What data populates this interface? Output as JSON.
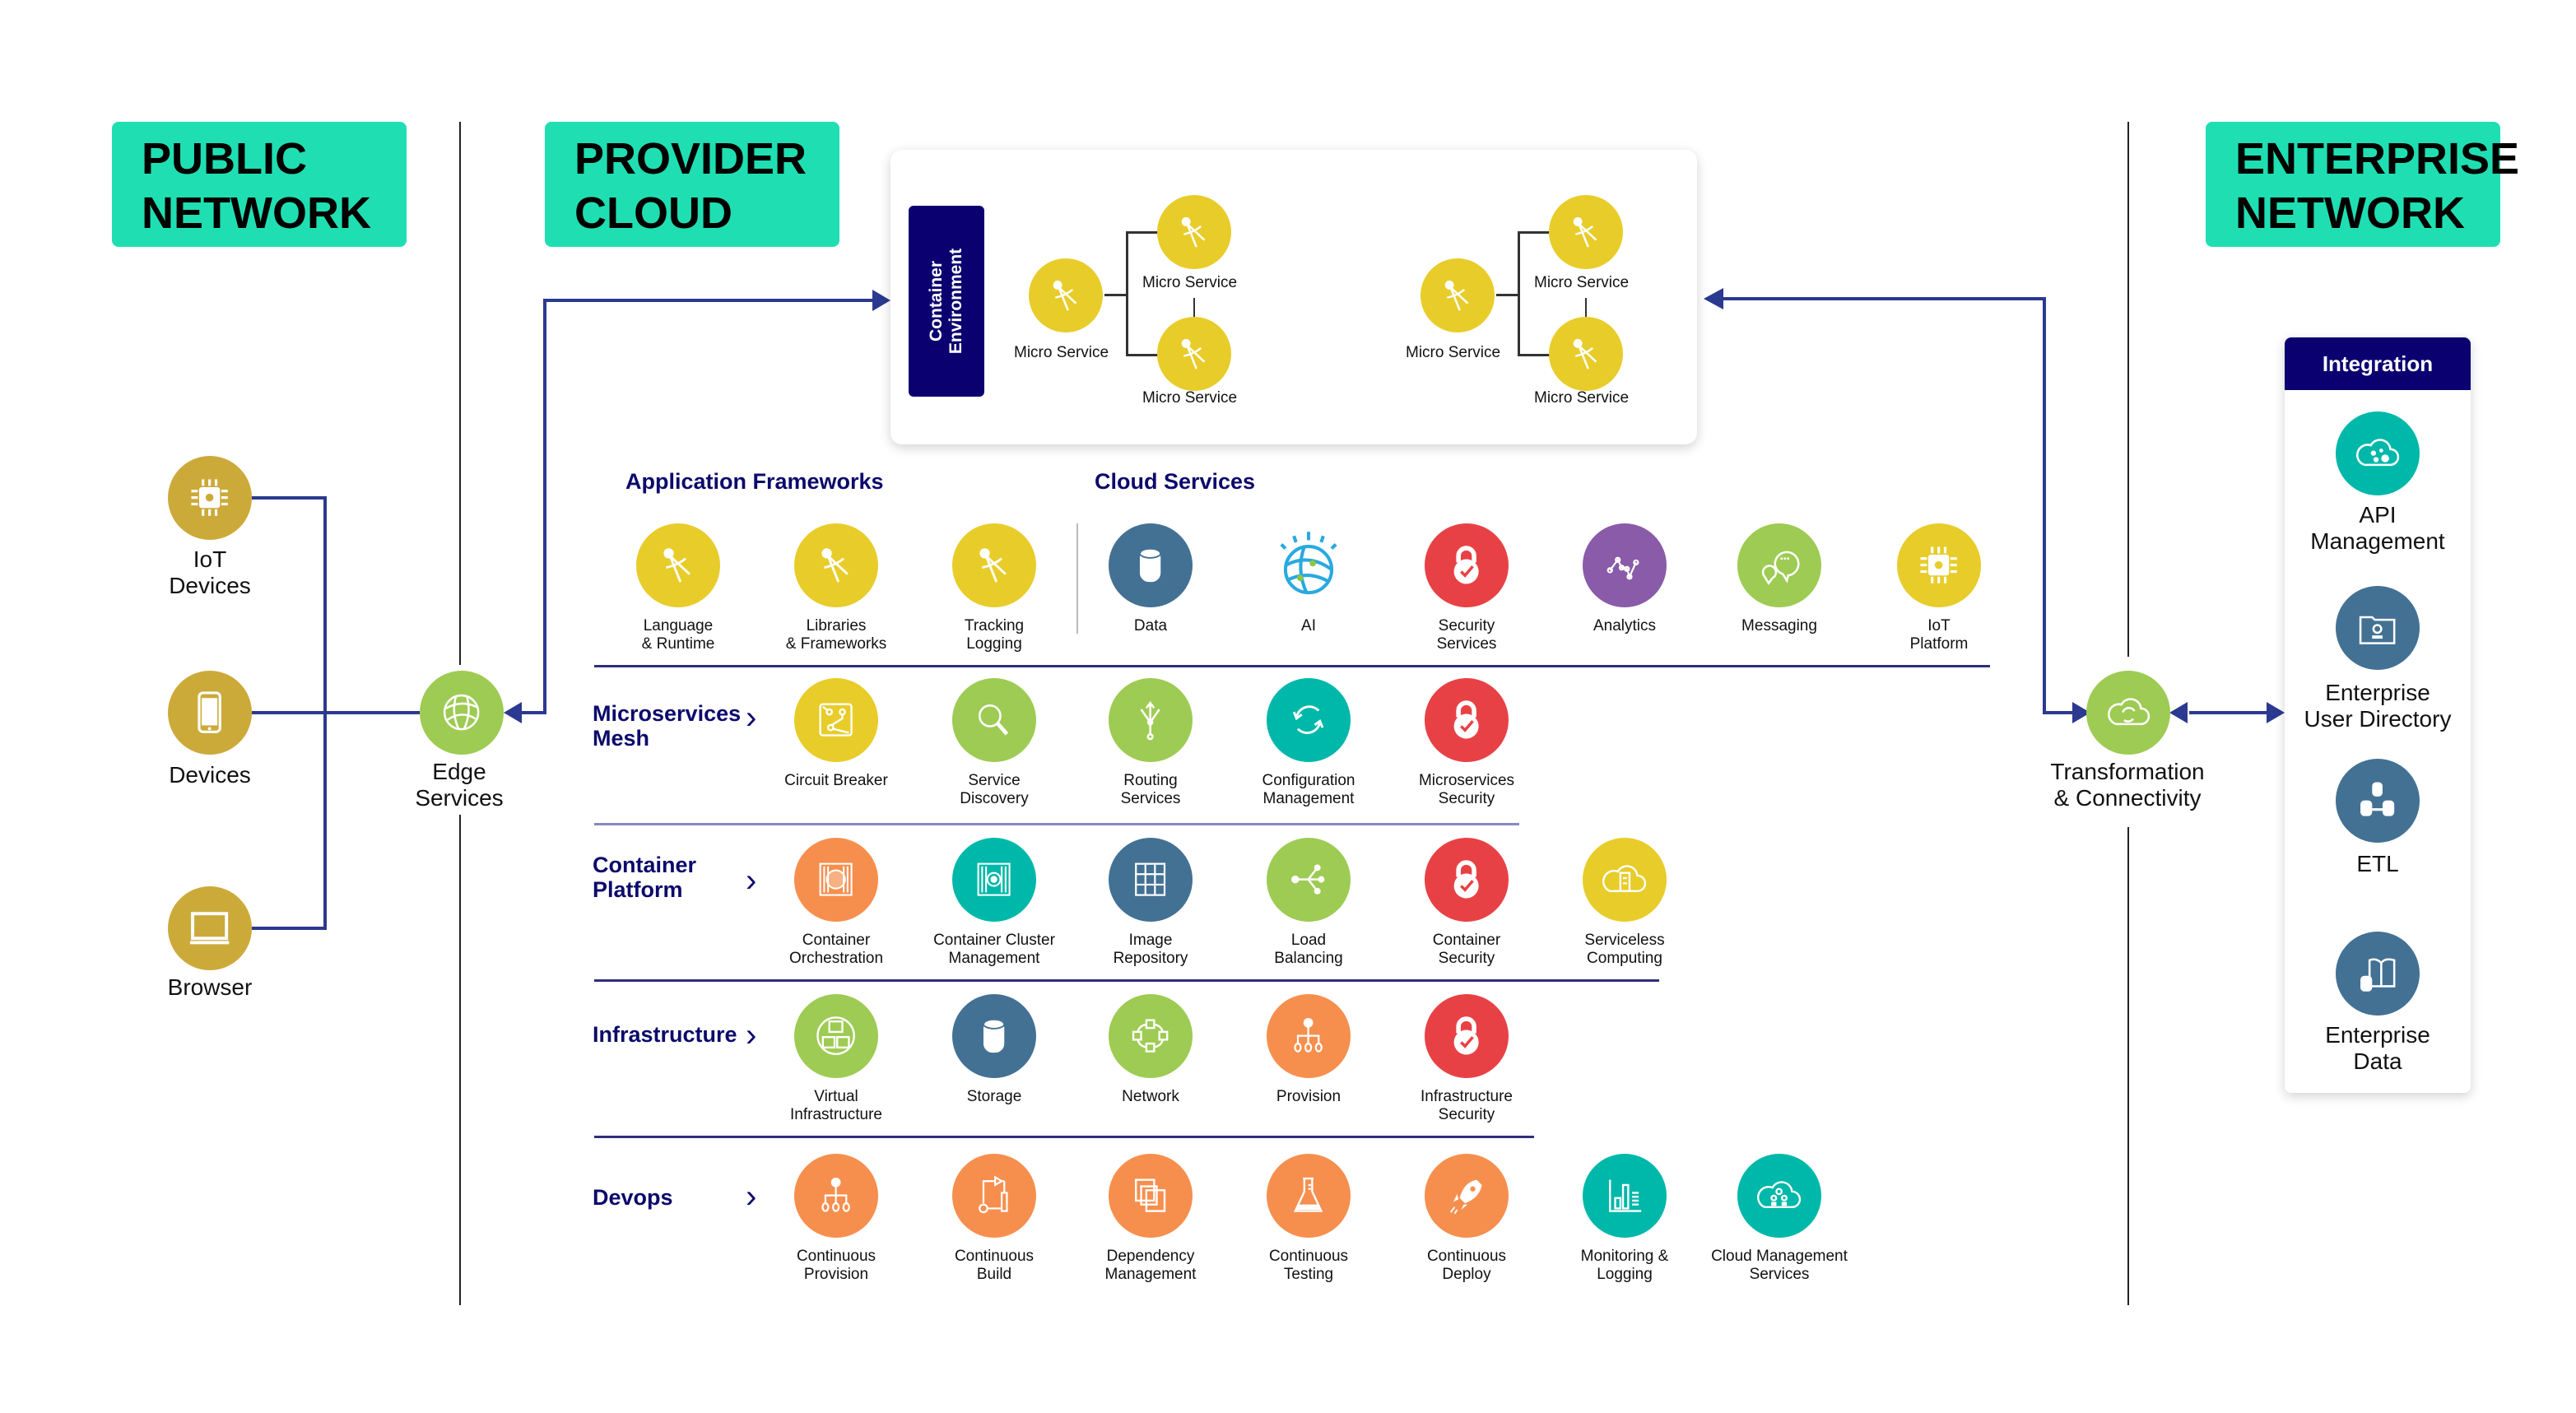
{
  "zones": {
    "public": "PUBLIC\nNETWORK",
    "provider": "PROVIDER\nCLOUD",
    "enterprise": "ENTERPRISE\nNETWORK"
  },
  "colors": {
    "zone_badge": "#1fdfb2",
    "navy": "#0b0070",
    "arrow": "#2b3990",
    "gold": "#ccaa3a",
    "yellow": "#e8cc2a",
    "green": "#9ecb53",
    "teal": "#00b8a9",
    "steel": "#437194",
    "red": "#e84145",
    "purple": "#8a5ba8",
    "orange": "#f68f4e"
  },
  "public_network": {
    "clients": [
      {
        "label": "IoT\nDevices",
        "icon": "chip-icon"
      },
      {
        "label": "Devices",
        "icon": "smartphone-icon"
      },
      {
        "label": "Browser",
        "icon": "monitor-icon"
      }
    ],
    "edge": {
      "label": "Edge\nServices",
      "icon": "globe-icon"
    }
  },
  "container_env": {
    "title": "Container\nEnvironment",
    "micro_label": "Micro Service"
  },
  "sections": {
    "app_frameworks": {
      "title": "Application Frameworks",
      "items": [
        {
          "label": "Language\n& Runtime"
        },
        {
          "label": "Libraries\n& Frameworks"
        },
        {
          "label": "Tracking\nLogging"
        }
      ]
    },
    "cloud_services": {
      "title": "Cloud Services",
      "items": [
        {
          "label": "Data"
        },
        {
          "label": "AI"
        },
        {
          "label": "Security\nServices"
        },
        {
          "label": "Analytics"
        },
        {
          "label": "Messaging"
        },
        {
          "label": "IoT\nPlatform"
        }
      ]
    },
    "mesh": {
      "title": "Microservices\nMesh",
      "items": [
        {
          "label": "Circuit Breaker"
        },
        {
          "label": "Service\nDiscovery"
        },
        {
          "label": "Routing\nServices"
        },
        {
          "label": "Configuration\nManagement"
        },
        {
          "label": "Microservices\nSecurity"
        }
      ]
    },
    "container": {
      "title": "Container\nPlatform",
      "items": [
        {
          "label": "Container\nOrchestration"
        },
        {
          "label": "Container Cluster\nManagement"
        },
        {
          "label": "Image\nRepository"
        },
        {
          "label": "Load\nBalancing"
        },
        {
          "label": "Container\nSecurity"
        },
        {
          "label": "Serviceless\nComputing"
        }
      ]
    },
    "infra": {
      "title": "Infrastructure",
      "items": [
        {
          "label": "Virtual\nInfrastructure"
        },
        {
          "label": "Storage"
        },
        {
          "label": "Network"
        },
        {
          "label": "Provision"
        },
        {
          "label": "Infrastructure\nSecurity"
        }
      ]
    },
    "devops": {
      "title": "Devops",
      "items": [
        {
          "label": "Continuous\nProvision"
        },
        {
          "label": "Continuous\nBuild"
        },
        {
          "label": "Dependency\nManagement"
        },
        {
          "label": "Continuous\nTesting"
        },
        {
          "label": "Continuous\nDeploy"
        },
        {
          "label": "Monitoring &\nLogging"
        },
        {
          "label": "Cloud Management\nServices"
        }
      ]
    }
  },
  "transformation": {
    "label": "Transformation\n& Connectivity"
  },
  "integration": {
    "title": "Integration",
    "items": [
      {
        "label": "API\nManagement"
      },
      {
        "label": "Enterprise\nUser Directory"
      },
      {
        "label": "ETL"
      },
      {
        "label": "Enterprise\nData"
      }
    ]
  }
}
